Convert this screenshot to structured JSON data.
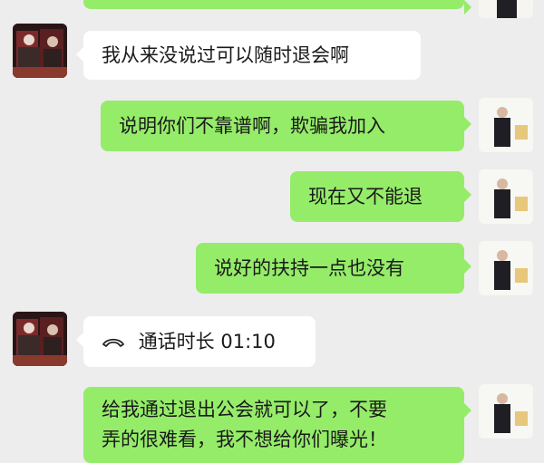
{
  "chat": {
    "messages": [
      {
        "side": "left",
        "text": "我从来没说过可以随时退会啊"
      },
      {
        "side": "right",
        "text": "说明你们不靠谱啊，欺骗我加入"
      },
      {
        "side": "right",
        "text": "现在又不能退"
      },
      {
        "side": "right",
        "text": "说好的扶持一点也没有"
      },
      {
        "side": "left",
        "type": "call",
        "icon": "phone-hangup-icon",
        "text": "通话时长 01:10"
      },
      {
        "side": "right",
        "lines": [
          "给我通过退出公会就可以了，不要",
          "弄的很难看，我不想给你们曝光！"
        ]
      }
    ]
  },
  "colors": {
    "background": "#ededed",
    "sent_bubble": "#95ec69",
    "received_bubble": "#ffffff",
    "text": "#1a1a1a"
  }
}
